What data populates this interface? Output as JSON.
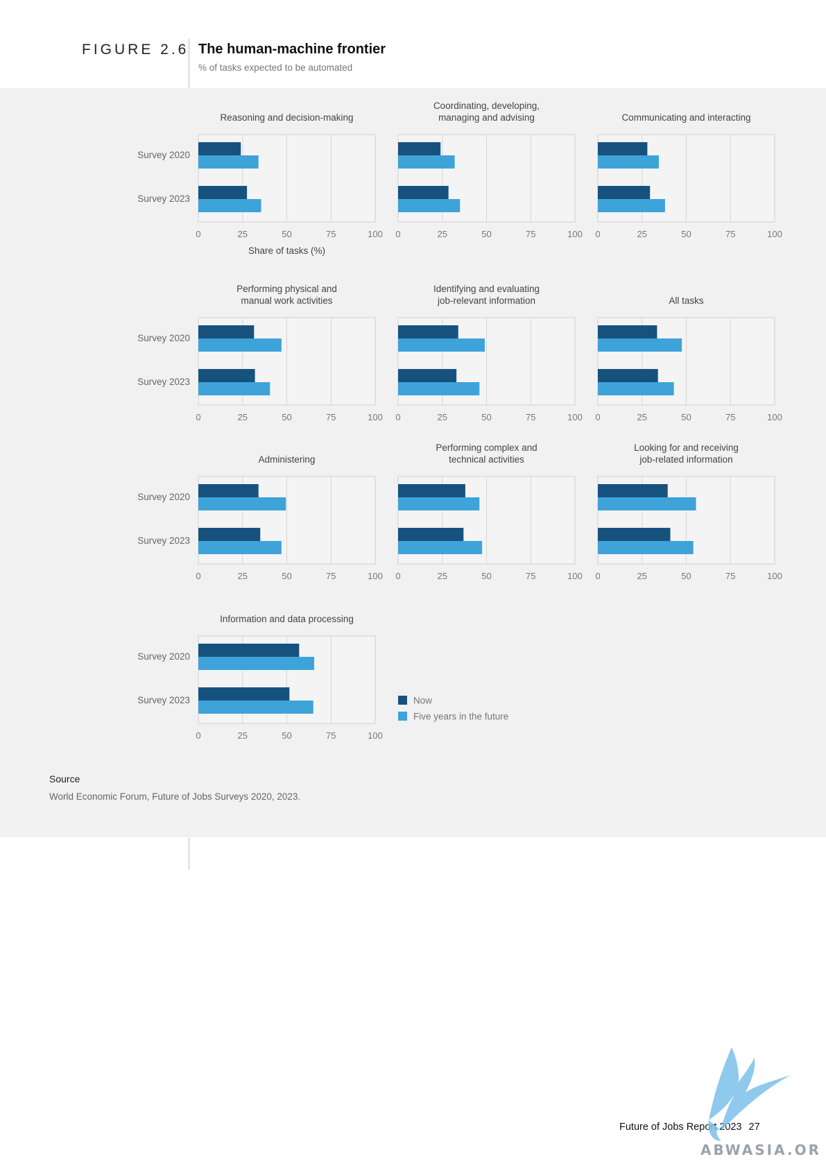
{
  "figure": {
    "label": "FIGURE 2.6",
    "title": "The human-machine frontier",
    "subtitle": "% of tasks expected to be automated"
  },
  "chart_data": {
    "type": "bar",
    "orientation": "horizontal",
    "categories": [
      "Survey 2020",
      "Survey 2023"
    ],
    "xlabel": "Share of tasks (%)",
    "xlim": [
      0,
      100
    ],
    "xticks": [
      "0",
      "25",
      "50",
      "75",
      "100"
    ],
    "grid": true,
    "legend": {
      "placement": "bottom-center",
      "entries": [
        {
          "name": "Now",
          "color": "#17527f"
        },
        {
          "name": "Five years in the future",
          "color": "#3ea3d9"
        }
      ]
    },
    "panels": [
      {
        "title": "Reasoning and decision-making",
        "series": [
          {
            "name": "Now",
            "values": [
              24,
              27.5
            ]
          },
          {
            "name": "Five years in the future",
            "values": [
              34,
              35.5
            ]
          }
        ]
      },
      {
        "title": "Coordinating, developing, managing and advising",
        "series": [
          {
            "name": "Now",
            "values": [
              24,
              28.5
            ]
          },
          {
            "name": "Five years in the future",
            "values": [
              32,
              35
            ]
          }
        ]
      },
      {
        "title": "Communicating and interacting",
        "series": [
          {
            "name": "Now",
            "values": [
              28,
              29.5
            ]
          },
          {
            "name": "Five years in the future",
            "values": [
              34.5,
              38
            ]
          }
        ]
      },
      {
        "title": "Performing physical and manual work activities",
        "series": [
          {
            "name": "Now",
            "values": [
              31.5,
              32
            ]
          },
          {
            "name": "Five years in the future",
            "values": [
              47,
              40.5
            ]
          }
        ]
      },
      {
        "title": "Identifying and evaluating job-relevant information",
        "series": [
          {
            "name": "Now",
            "values": [
              34,
              33
            ]
          },
          {
            "name": "Five years in the future",
            "values": [
              49,
              46
            ]
          }
        ]
      },
      {
        "title": "All tasks",
        "series": [
          {
            "name": "Now",
            "values": [
              33.5,
              34
            ]
          },
          {
            "name": "Five years in the future",
            "values": [
              47.5,
              43
            ]
          }
        ]
      },
      {
        "title": "Administering",
        "series": [
          {
            "name": "Now",
            "values": [
              34,
              35
            ]
          },
          {
            "name": "Five years in the future",
            "values": [
              49.5,
              47
            ]
          }
        ]
      },
      {
        "title": "Performing complex and technical activities",
        "series": [
          {
            "name": "Now",
            "values": [
              38,
              37
            ]
          },
          {
            "name": "Five years in the future",
            "values": [
              46,
              47.5
            ]
          }
        ]
      },
      {
        "title": "Looking for and receiving job-related information",
        "series": [
          {
            "name": "Now",
            "values": [
              39.5,
              41
            ]
          },
          {
            "name": "Five years in the future",
            "values": [
              55.5,
              54
            ]
          }
        ]
      },
      {
        "title": "Information and data processing",
        "series": [
          {
            "name": "Now",
            "values": [
              57,
              51.5
            ]
          },
          {
            "name": "Five years in the future",
            "values": [
              65.5,
              65
            ]
          }
        ]
      }
    ]
  },
  "source": {
    "label": "Source",
    "text": "World Economic Forum, Future of Jobs Surveys 2020, 2023."
  },
  "footer": {
    "report": "Future of Jobs Report 2023",
    "page": "27"
  },
  "watermark": {
    "text": "ABWASIA.ORG",
    "icon": "bird-logo-icon"
  }
}
